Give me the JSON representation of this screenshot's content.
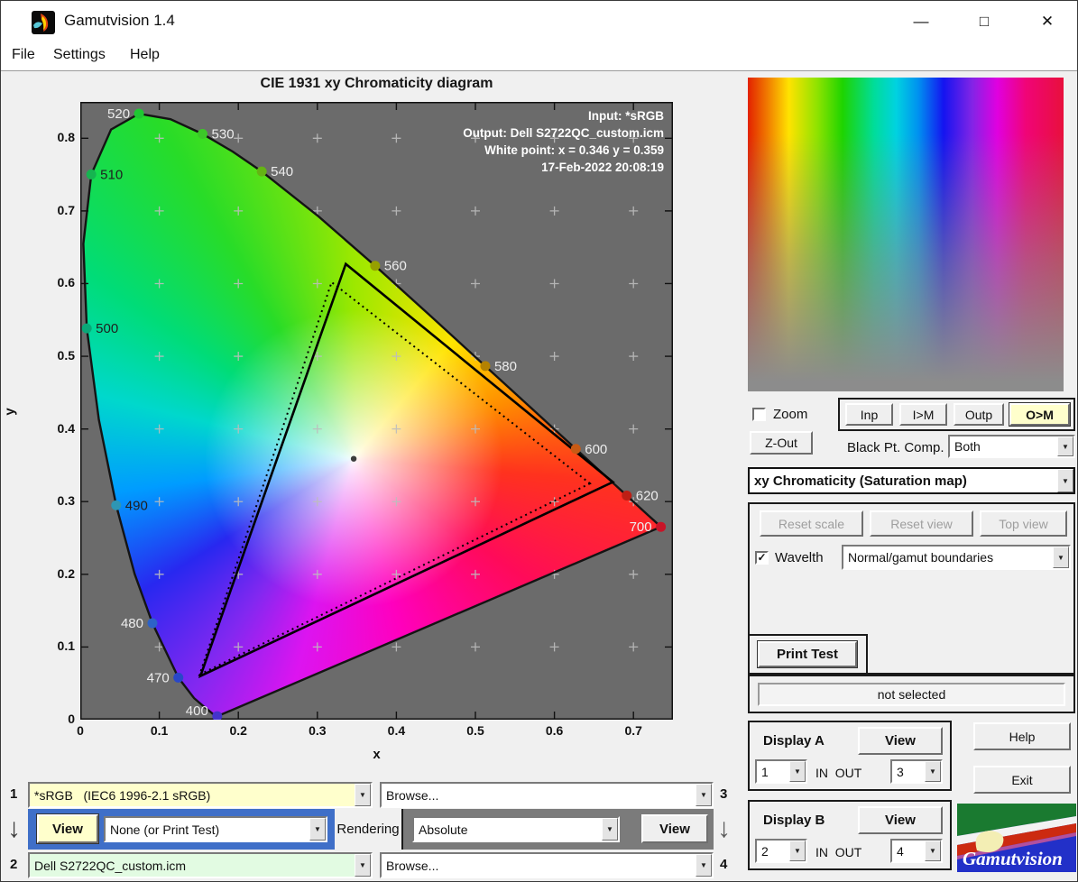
{
  "window": {
    "title": "Gamutvision 1.4",
    "menu": [
      "File",
      "Settings",
      "Help"
    ],
    "controls": {
      "minimize": "—",
      "maximize": "□",
      "close": "✕"
    }
  },
  "chart_data": {
    "type": "scatter",
    "title": "CIE 1931 xy Chromaticity diagram",
    "xlabel": "x",
    "ylabel": "y",
    "xlim": [
      0,
      0.75
    ],
    "ylim": [
      0,
      0.85
    ],
    "grid": true,
    "annotations": [
      "Input:  *sRGB",
      "Output: Dell S2722QC_custom.icm",
      "White point:  x = 0.346  y = 0.359",
      "17-Feb-2022 20:08:19"
    ],
    "x_tick_vals": [
      0,
      0.1,
      0.2,
      0.3,
      0.4,
      0.5,
      0.6,
      0.7
    ],
    "x_tick_labels": [
      "0",
      "0.1",
      "0.2",
      "0.3",
      "0.4",
      "0.5",
      "0.6",
      "0.7"
    ],
    "y_tick_vals": [
      0,
      0.1,
      0.2,
      0.3,
      0.4,
      0.5,
      0.6,
      0.7,
      0.8
    ],
    "y_tick_labels": [
      "0",
      "0.1",
      "0.2",
      "0.3",
      "0.4",
      "0.5",
      "0.6",
      "0.7",
      "0.8"
    ],
    "white_point": {
      "x": 0.346,
      "y": 0.359
    },
    "spectral_locus": [
      [
        380,
        0.1741,
        0.005
      ],
      [
        400,
        0.1733,
        0.0048
      ],
      [
        410,
        0.1726,
        0.0048
      ],
      [
        420,
        0.1714,
        0.0051
      ],
      [
        430,
        0.1689,
        0.0069
      ],
      [
        440,
        0.1644,
        0.0109
      ],
      [
        450,
        0.1566,
        0.0177
      ],
      [
        460,
        0.144,
        0.0297
      ],
      [
        470,
        0.1241,
        0.0578
      ],
      [
        480,
        0.0913,
        0.1327
      ],
      [
        485,
        0.0687,
        0.2007
      ],
      [
        490,
        0.0454,
        0.295
      ],
      [
        495,
        0.0235,
        0.4127
      ],
      [
        500,
        0.0082,
        0.5384
      ],
      [
        505,
        0.0039,
        0.6548
      ],
      [
        510,
        0.0139,
        0.7502
      ],
      [
        515,
        0.0389,
        0.812
      ],
      [
        520,
        0.0743,
        0.8338
      ],
      [
        525,
        0.1142,
        0.8262
      ],
      [
        530,
        0.1547,
        0.8059
      ],
      [
        535,
        0.1929,
        0.7816
      ],
      [
        540,
        0.2296,
        0.7543
      ],
      [
        550,
        0.3016,
        0.6923
      ],
      [
        560,
        0.3731,
        0.6245
      ],
      [
        570,
        0.4441,
        0.5547
      ],
      [
        580,
        0.5125,
        0.4866
      ],
      [
        590,
        0.5752,
        0.4242
      ],
      [
        600,
        0.627,
        0.3725
      ],
      [
        610,
        0.6658,
        0.334
      ],
      [
        620,
        0.6915,
        0.3083
      ],
      [
        630,
        0.7079,
        0.292
      ],
      [
        640,
        0.719,
        0.2809
      ],
      [
        650,
        0.726,
        0.274
      ],
      [
        700,
        0.7347,
        0.2653
      ]
    ],
    "wavelength_markers": [
      {
        "wl": "400",
        "x": 0.1733,
        "y": 0.0048,
        "color": "#4433cc",
        "label_side": "left",
        "label_color": "#ededed",
        "dy": -1
      },
      {
        "wl": "470",
        "x": 0.1241,
        "y": 0.0578,
        "color": "#2947c8",
        "label_side": "left",
        "label_color": "#ededed",
        "dy": 5
      },
      {
        "wl": "480",
        "x": 0.0913,
        "y": 0.1327,
        "color": "#2d62c8",
        "label_side": "left",
        "label_color": "#ededed",
        "dy": 5
      },
      {
        "wl": "490",
        "x": 0.0454,
        "y": 0.295,
        "color": "#2e96b4",
        "label_side": "right",
        "label_color": "#1f1f1f",
        "dy": 5
      },
      {
        "wl": "500",
        "x": 0.0082,
        "y": 0.5384,
        "color": "#0aa878",
        "label_side": "right",
        "label_color": "#1f1f1f",
        "dy": 5
      },
      {
        "wl": "510",
        "x": 0.0139,
        "y": 0.7502,
        "color": "#16b450",
        "label_side": "right",
        "label_color": "#1f1f1f",
        "dy": 5
      },
      {
        "wl": "520",
        "x": 0.0743,
        "y": 0.8338,
        "color": "#1ec832",
        "label_side": "left",
        "label_color": "#ededed",
        "dy": 5
      },
      {
        "wl": "530",
        "x": 0.1547,
        "y": 0.8059,
        "color": "#3cc828",
        "label_side": "right",
        "label_color": "#ededed",
        "dy": 5
      },
      {
        "wl": "540",
        "x": 0.2296,
        "y": 0.7543,
        "color": "#64b414",
        "label_side": "right",
        "label_color": "#ededed",
        "dy": 5
      },
      {
        "wl": "560",
        "x": 0.3731,
        "y": 0.6245,
        "color": "#96a000",
        "label_side": "right",
        "label_color": "#ededed",
        "dy": 5
      },
      {
        "wl": "580",
        "x": 0.5125,
        "y": 0.4866,
        "color": "#b48200",
        "label_side": "right",
        "label_color": "#ededed",
        "dy": 5
      },
      {
        "wl": "600",
        "x": 0.627,
        "y": 0.3725,
        "color": "#c85a14",
        "label_side": "right",
        "label_color": "#ededed",
        "dy": 5
      },
      {
        "wl": "620",
        "x": 0.6915,
        "y": 0.3083,
        "color": "#be1e14",
        "label_side": "right",
        "label_color": "#ededed",
        "dy": 5
      },
      {
        "wl": "700",
        "x": 0.7347,
        "y": 0.2653,
        "color": "#c81428",
        "label_side": "left",
        "label_color": "#ededed",
        "dy": 5
      }
    ],
    "gamut_triangles": [
      {
        "name": "output Dell S2722QC_custom.icm",
        "style": "solid",
        "points": [
          [
            0.674,
            0.327
          ],
          [
            0.336,
            0.627
          ],
          [
            0.152,
            0.06
          ]
        ]
      },
      {
        "name": "input *sRGB",
        "style": "dotted",
        "points": [
          [
            0.645,
            0.325
          ],
          [
            0.318,
            0.602
          ],
          [
            0.151,
            0.062
          ]
        ]
      }
    ]
  },
  "right_panel": {
    "zoom_checkbox": {
      "label": "Zoom",
      "checked": false
    },
    "map_buttons": [
      {
        "label": "Inp",
        "active": false
      },
      {
        "label": "I>M",
        "active": false
      },
      {
        "label": "Outp",
        "active": false
      },
      {
        "label": "O>M",
        "active": true
      }
    ],
    "zout_button": "Z-Out",
    "black_pt_comp": {
      "label": "Black Pt. Comp.",
      "value": "Both"
    },
    "view_mode": "xy Chromaticity (Saturation map)",
    "reset_scale": "Reset scale",
    "reset_view": "Reset view",
    "top_view": "Top view",
    "wavelth": {
      "label": "Wavelth",
      "checked": true
    },
    "boundaries": "Normal/gamut boundaries",
    "print_test": "Print Test",
    "status": "not selected",
    "display_a": {
      "title": "Display A",
      "view": "View",
      "in": "1",
      "inout": "IN  OUT",
      "out": "3"
    },
    "display_b": {
      "title": "Display B",
      "view": "View",
      "in": "2",
      "inout": "IN  OUT",
      "out": "4"
    },
    "help": "Help",
    "exit": "Exit",
    "logo_text": "Gamutvision"
  },
  "bottom": {
    "row1": {
      "num": "1",
      "profile": "*sRGB   (IEC6 1996-2.1 sRGB)",
      "browse": "Browse...",
      "num_right": "3"
    },
    "mid": {
      "view_left": "View",
      "intent_none": "None (or Print Test)",
      "rendering": "Rendering",
      "intent": "Absolute",
      "view_right": "View"
    },
    "row2": {
      "num": "2",
      "profile": "Dell S2722QC_custom.icm",
      "browse": "Browse...",
      "num_right": "4"
    }
  }
}
